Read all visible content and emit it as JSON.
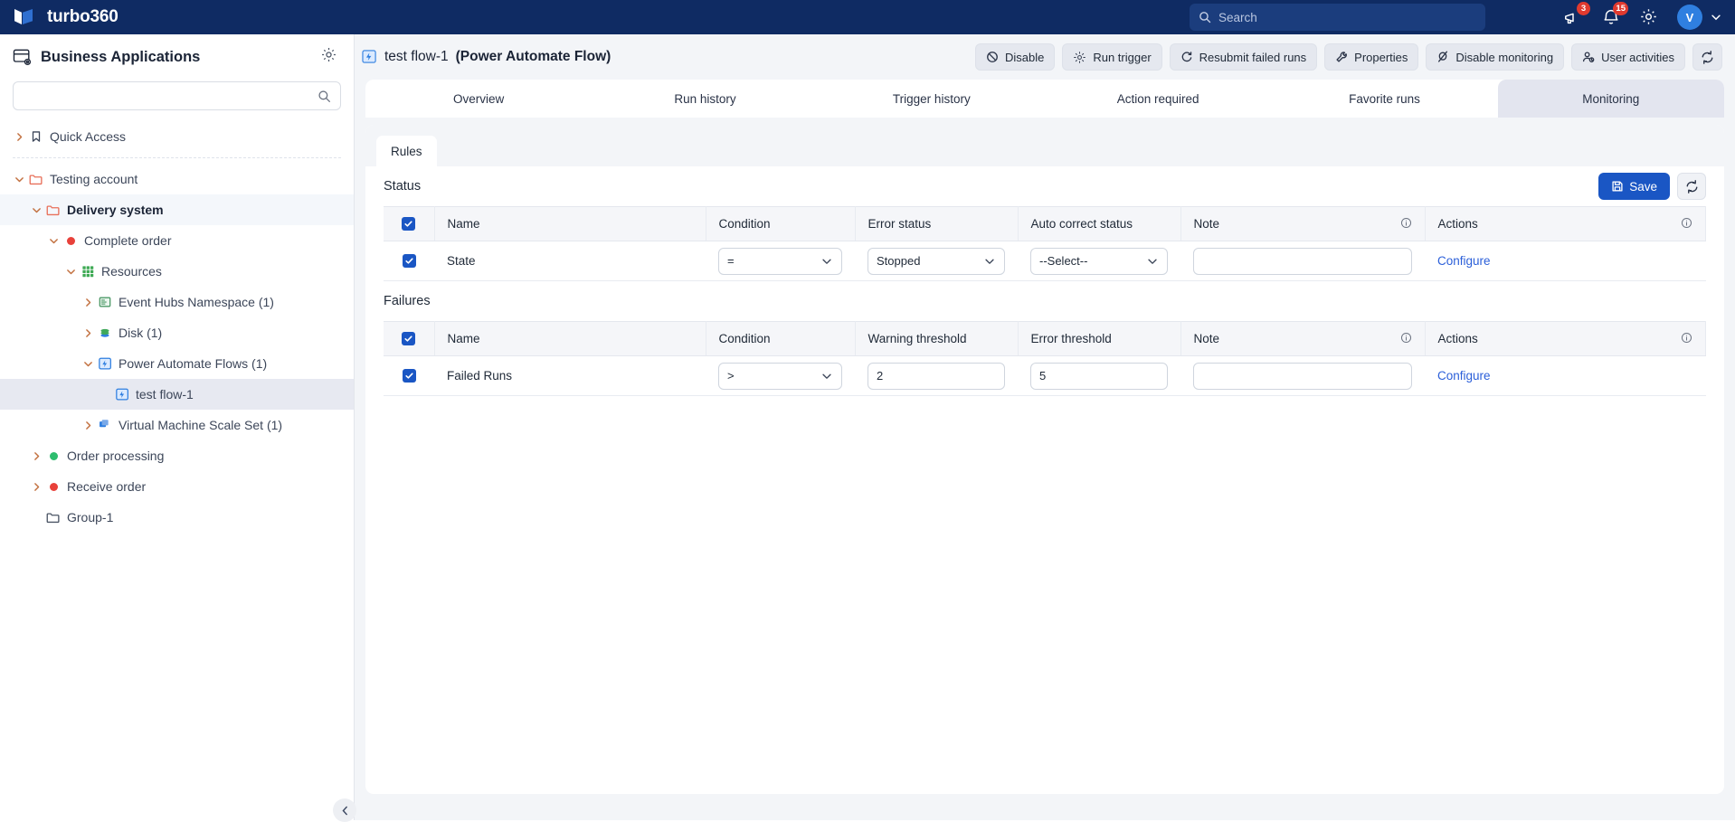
{
  "topbar": {
    "brand": "turbo360",
    "search_placeholder": "Search",
    "announcements_badge": "3",
    "notifications_badge": "15",
    "avatar_initial": "V",
    "accent": "#0f2b63"
  },
  "sidebar": {
    "title": "Business Applications",
    "search_placeholder": "",
    "tree": [
      {
        "label": "Quick Access",
        "icon": "bookmark-icon",
        "indent": 0,
        "chevron": "right",
        "bold": false,
        "state": "normal"
      },
      {
        "label": "Testing account",
        "icon": "folder-icon",
        "indent": 0,
        "chevron": "down",
        "bold": false,
        "state": "normal"
      },
      {
        "label": "Delivery system",
        "icon": "folder-icon",
        "indent": 1,
        "chevron": "down",
        "bold": true,
        "state": "selected-light"
      },
      {
        "label": "Complete order",
        "icon": "status-dot-red",
        "indent": 2,
        "chevron": "down",
        "bold": false,
        "state": "normal"
      },
      {
        "label": "Resources",
        "icon": "grid-icon",
        "indent": 3,
        "chevron": "down",
        "bold": false,
        "state": "normal"
      },
      {
        "label": "Event Hubs Namespace (1)",
        "icon": "event-hubs-icon",
        "indent": 4,
        "chevron": "right",
        "bold": false,
        "state": "normal"
      },
      {
        "label": "Disk (1)",
        "icon": "disk-icon",
        "indent": 4,
        "chevron": "right",
        "bold": false,
        "state": "normal"
      },
      {
        "label": "Power Automate Flows (1)",
        "icon": "power-automate-icon",
        "indent": 4,
        "chevron": "down",
        "bold": false,
        "state": "normal"
      },
      {
        "label": "test flow-1",
        "icon": "power-automate-icon",
        "indent": 5,
        "chevron": "none",
        "bold": false,
        "state": "selected"
      },
      {
        "label": "Virtual Machine Scale Set (1)",
        "icon": "vmss-icon",
        "indent": 4,
        "chevron": "right",
        "bold": false,
        "state": "normal"
      },
      {
        "label": "Order processing",
        "icon": "status-dot-green",
        "indent": 1,
        "chevron": "right",
        "bold": false,
        "state": "normal"
      },
      {
        "label": "Receive order",
        "icon": "status-dot-red",
        "indent": 1,
        "chevron": "right",
        "bold": false,
        "state": "normal"
      },
      {
        "label": "Group-1",
        "icon": "folder-plain-icon",
        "indent": 1,
        "chevron": "none",
        "bold": false,
        "state": "normal"
      }
    ]
  },
  "main": {
    "resource_name": "test flow-1",
    "resource_type": "(Power Automate Flow)",
    "toolbar": [
      {
        "label": "Disable",
        "icon": "disable-icon"
      },
      {
        "label": "Run trigger",
        "icon": "gear-icon"
      },
      {
        "label": "Resubmit failed runs",
        "icon": "refresh-arrow-icon"
      },
      {
        "label": "Properties",
        "icon": "wrench-icon"
      },
      {
        "label": "Disable monitoring",
        "icon": "monitor-off-icon"
      },
      {
        "label": "User activities",
        "icon": "user-activity-icon"
      }
    ],
    "refresh_icon": "refresh-icon",
    "tabs": [
      {
        "label": "Overview",
        "active": false
      },
      {
        "label": "Run history",
        "active": false
      },
      {
        "label": "Trigger history",
        "active": false
      },
      {
        "label": "Action required",
        "active": false
      },
      {
        "label": "Favorite runs",
        "active": false
      },
      {
        "label": "Monitoring",
        "active": true
      }
    ],
    "subtabs": [
      {
        "label": "Rules",
        "active": true
      }
    ],
    "save_label": "Save",
    "sections": [
      {
        "title": "Status",
        "columns": [
          "Name",
          "Condition",
          "Error status",
          "Auto correct status",
          "Note",
          "Actions"
        ],
        "rows": [
          {
            "checked": true,
            "name": "State",
            "condition": "=",
            "field2": "Stopped",
            "field3": "--Select--",
            "note": "",
            "action": "Configure"
          }
        ]
      },
      {
        "title": "Failures",
        "columns": [
          "Name",
          "Condition",
          "Warning threshold",
          "Error threshold",
          "Note",
          "Actions"
        ],
        "rows": [
          {
            "checked": true,
            "name": "Failed Runs",
            "condition": ">",
            "field2": "2",
            "field3": "5",
            "note": "",
            "action": "Configure"
          }
        ]
      }
    ]
  }
}
